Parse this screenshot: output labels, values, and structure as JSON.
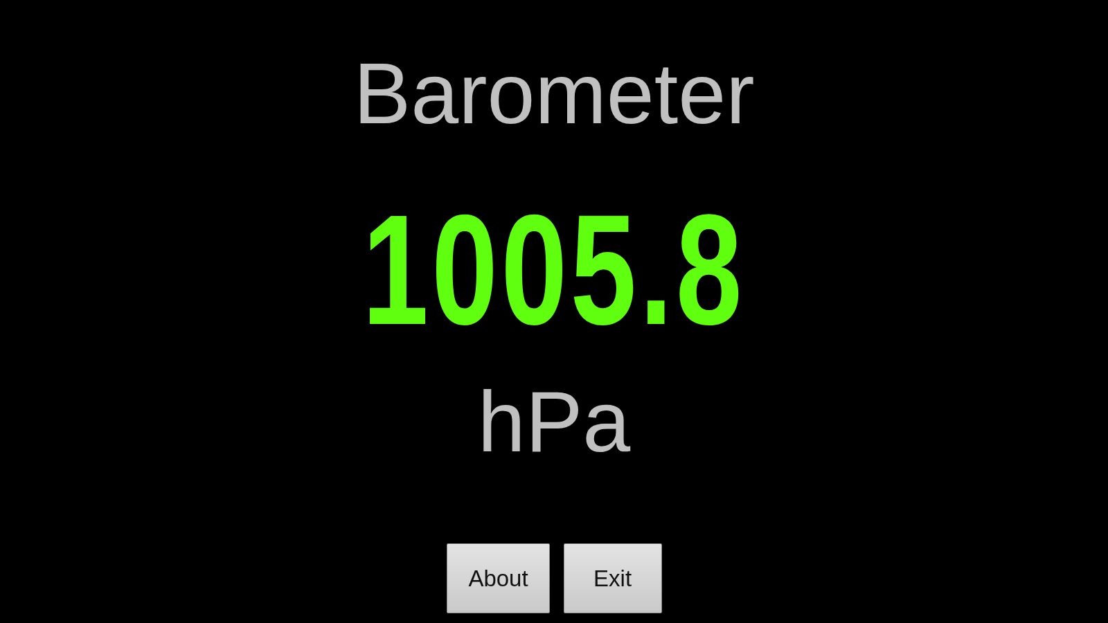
{
  "app": {
    "title": "Barometer"
  },
  "reading": {
    "value": "1005.8",
    "unit": "hPa"
  },
  "buttons": [
    {
      "label": "About"
    },
    {
      "label": "Exit"
    }
  ]
}
